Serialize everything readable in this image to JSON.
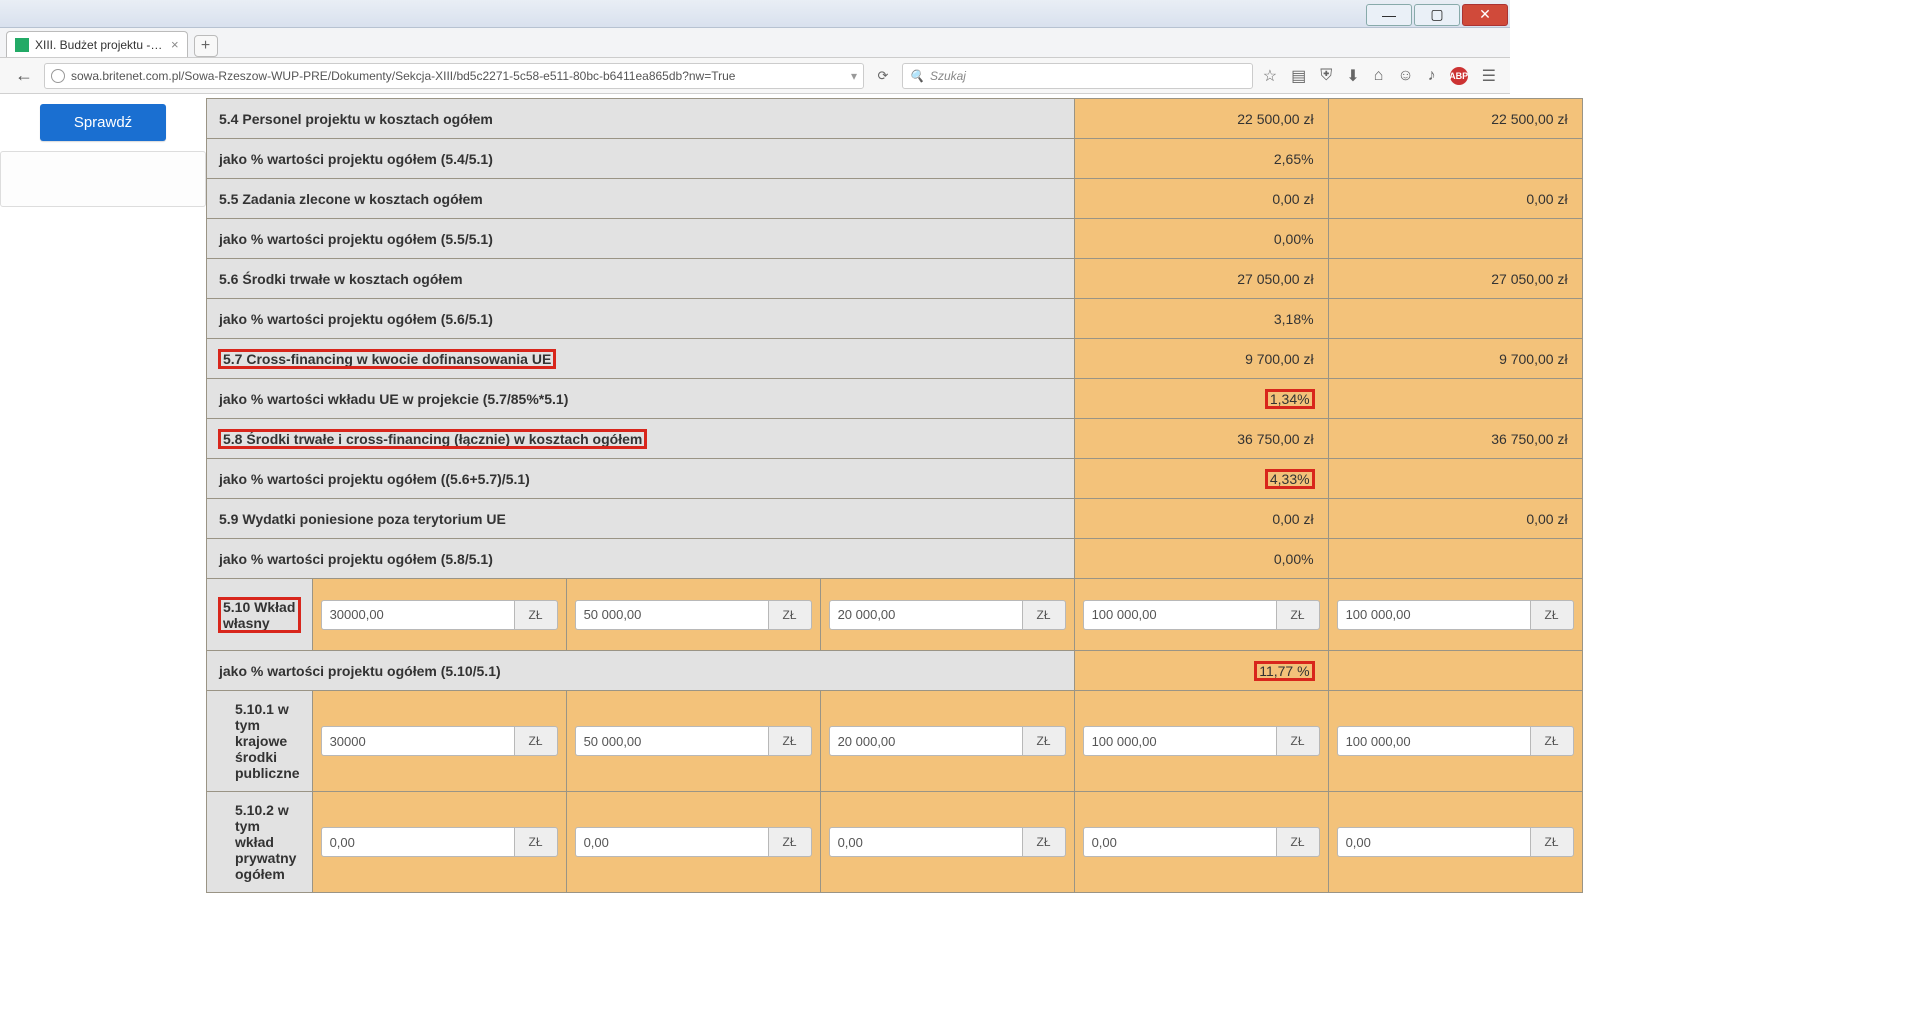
{
  "window": {
    "tab_title": "XIII. Budżet projektu - LSI ...",
    "url": "sowa.britenet.com.pl/Sowa-Rzeszow-WUP-PRE/Dokumenty/Sekcja-XIII/bd5c2271-5c58-e511-80bc-b6411ea865db?nw=True",
    "search_placeholder": "Szukaj"
  },
  "sidebar": {
    "check_button": "Sprawdź"
  },
  "currency_unit": "ZŁ",
  "rows": {
    "r54": {
      "label": "5.4 Personel projektu w kosztach ogółem",
      "v1": "22 500,00 zł",
      "v2": "22 500,00 zł"
    },
    "r54p": {
      "label": "jako % wartości projektu ogółem (5.4/5.1)",
      "v1": "2,65%"
    },
    "r55": {
      "label": "5.5 Zadania zlecone w kosztach ogółem",
      "v1": "0,00 zł",
      "v2": "0,00 zł"
    },
    "r55p": {
      "label": "jako % wartości projektu ogółem (5.5/5.1)",
      "v1": "0,00%"
    },
    "r56": {
      "label": "5.6 Środki trwałe w kosztach ogółem",
      "v1": "27 050,00 zł",
      "v2": "27 050,00 zł"
    },
    "r56p": {
      "label": "jako % wartości projektu ogółem (5.6/5.1)",
      "v1": "3,18%"
    },
    "r57": {
      "label": "5.7 Cross-financing w kwocie dofinansowania UE",
      "v1": "9 700,00 zł",
      "v2": "9 700,00 zł"
    },
    "r57p": {
      "label": "jako % wartości wkładu UE w projekcie (5.7/85%*5.1)",
      "v1": "1,34%"
    },
    "r58": {
      "label": "5.8 Środki trwałe i cross-financing (łącznie) w kosztach ogółem",
      "v1": "36 750,00 zł",
      "v2": "36 750,00 zł"
    },
    "r58p": {
      "label": "jako % wartości projektu ogółem ((5.6+5.7)/5.1)",
      "v1": "4,33%"
    },
    "r59": {
      "label": "5.9 Wydatki poniesione poza terytorium UE",
      "v1": "0,00 zł",
      "v2": "0,00 zł"
    },
    "r59p": {
      "label": "jako % wartości projektu ogółem (5.8/5.1)",
      "v1": "0,00%"
    },
    "r510": {
      "label": "5.10 Wkład własny",
      "i1": "30000,00",
      "i2": "50 000,00",
      "i3": "20 000,00",
      "s1": "100 000,00",
      "s2": "100 000,00"
    },
    "r510p": {
      "label": "jako % wartości projektu ogółem (5.10/5.1)",
      "v1": "11,77 %"
    },
    "r5101": {
      "label": "5.10.1 w tym krajowe środki publiczne",
      "i1": "30000",
      "i2": "50 000,00",
      "i3": "20 000,00",
      "s1": "100 000,00",
      "s2": "100 000,00"
    },
    "r5102": {
      "label": "5.10.2 w tym wkład prywatny ogółem",
      "i1": "0,00",
      "i2": "0,00",
      "i3": "0,00",
      "s1": "0,00",
      "s2": "0,00"
    }
  }
}
